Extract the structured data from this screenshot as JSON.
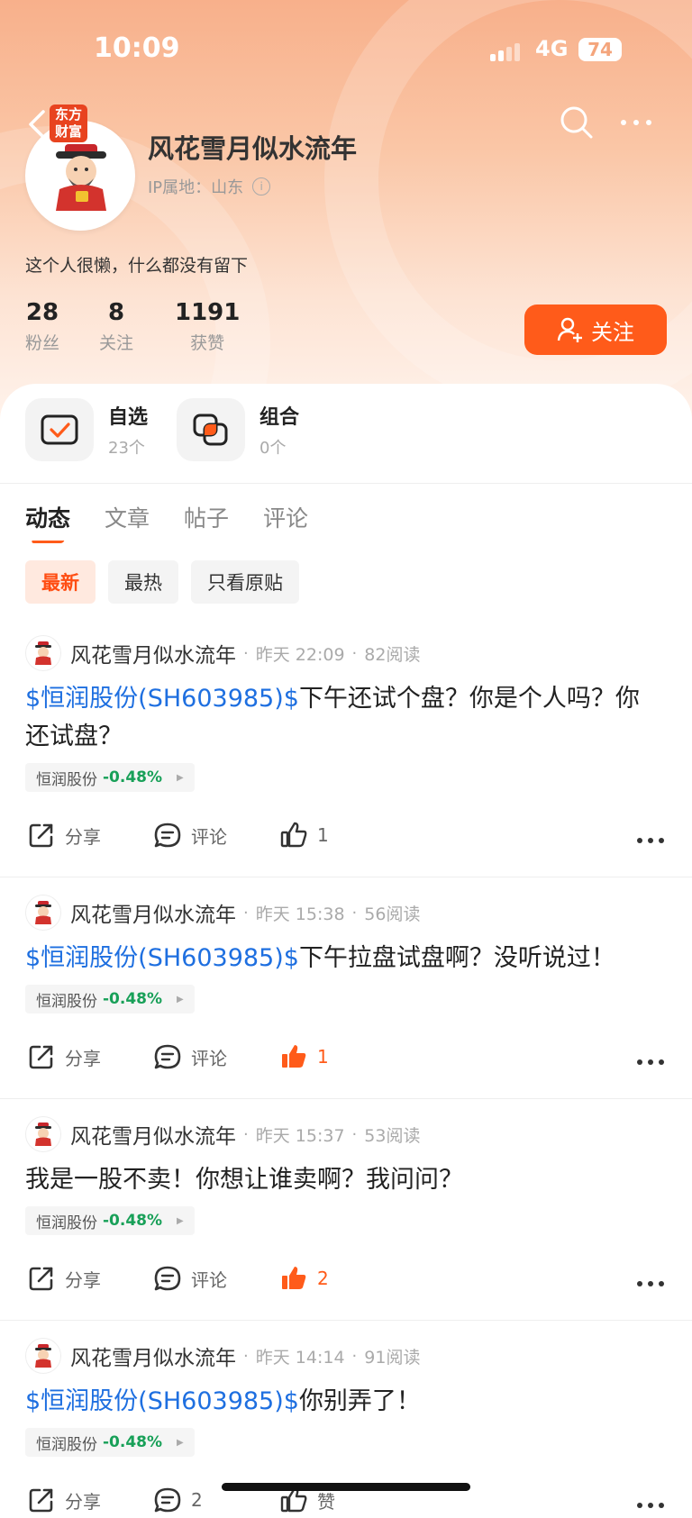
{
  "status_bar": {
    "time": "10:09",
    "network": "4G",
    "battery": "74"
  },
  "profile": {
    "brand_badge": "东方财富",
    "name": "风花雪月似水流年",
    "ip_location": "IP属地：山东",
    "bio": "这个人很懒，什么都没有留下",
    "stats": [
      {
        "value": "28",
        "label": "粉丝"
      },
      {
        "value": "8",
        "label": "关注"
      },
      {
        "value": "1191",
        "label": "获赞"
      }
    ],
    "follow_label": "关注"
  },
  "quick_entries": [
    {
      "title": "自选",
      "count": "23个"
    },
    {
      "title": "组合",
      "count": "0个"
    }
  ],
  "tabs": [
    "动态",
    "文章",
    "帖子",
    "评论"
  ],
  "active_tab": "动态",
  "filters": [
    "最新",
    "最热",
    "只看原贴"
  ],
  "active_filter": "最新",
  "posts": [
    {
      "author": "风花雪月似水流年",
      "time": "昨天 22:09",
      "reads": "82阅读",
      "stock_tag": "$恒润股份(SH603985)$",
      "text": "下午还试个盘？你是个人吗？你还试盘？",
      "chip_name": "恒润股份",
      "chip_change": "-0.48%",
      "share": "分享",
      "comment": "评论",
      "likes": "1",
      "liked": false
    },
    {
      "author": "风花雪月似水流年",
      "time": "昨天 15:38",
      "reads": "56阅读",
      "stock_tag": "$恒润股份(SH603985)$",
      "text": "下午拉盘试盘啊？没听说过！",
      "chip_name": "恒润股份",
      "chip_change": "-0.48%",
      "share": "分享",
      "comment": "评论",
      "likes": "1",
      "liked": true
    },
    {
      "author": "风花雪月似水流年",
      "time": "昨天 15:37",
      "reads": "53阅读",
      "stock_tag": "",
      "text": "我是一股不卖！你想让谁卖啊？我问问？",
      "chip_name": "恒润股份",
      "chip_change": "-0.48%",
      "share": "分享",
      "comment": "评论",
      "likes": "2",
      "liked": true
    },
    {
      "author": "风花雪月似水流年",
      "time": "昨天 14:14",
      "reads": "91阅读",
      "stock_tag": "$恒润股份(SH603985)$",
      "text": "你别弄了！",
      "chip_name": "恒润股份",
      "chip_change": "-0.48%",
      "share": "分享",
      "comment": "2",
      "likes": "赞",
      "liked": false
    }
  ],
  "colors": {
    "accent": "#ff5b1a",
    "link": "#1e6fe0",
    "down": "#18a058"
  }
}
